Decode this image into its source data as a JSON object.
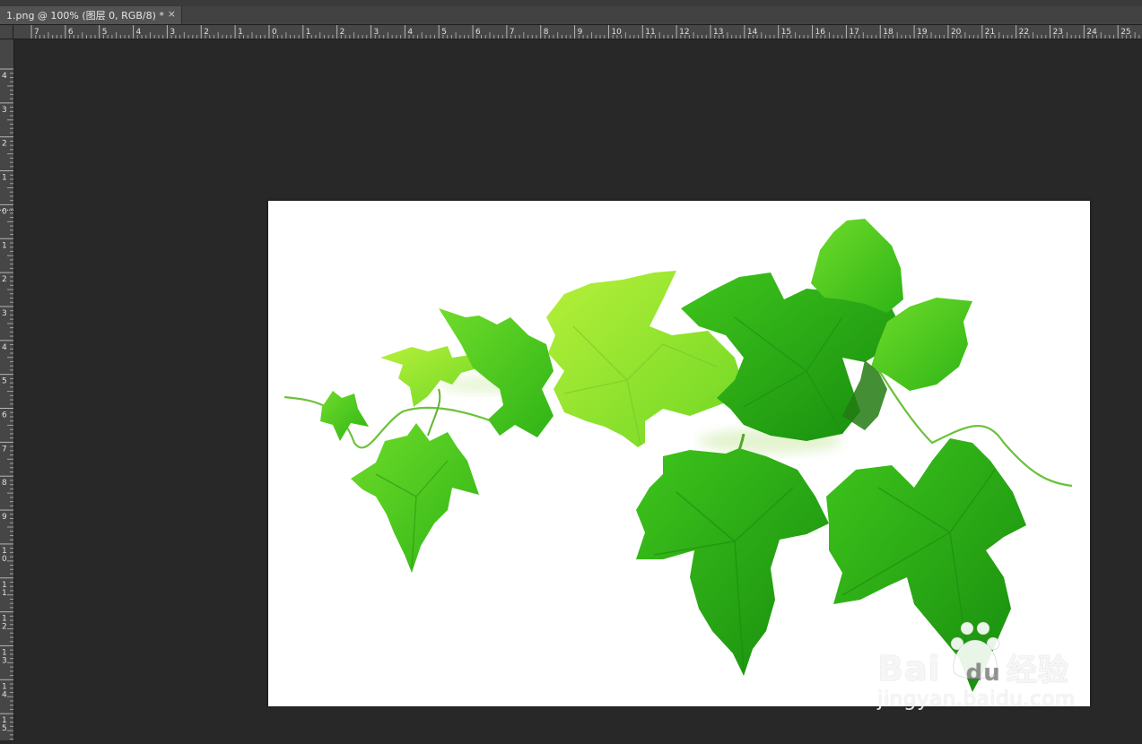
{
  "document_tab": {
    "title": "1.png @ 100% (图层 0, RGB/8) *",
    "close_glyph": "×"
  },
  "rulers": {
    "horizontal_labels": [
      "7",
      "6",
      "5",
      "4",
      "3",
      "2",
      "1",
      "0",
      "1",
      "2",
      "3",
      "4",
      "5",
      "6",
      "7",
      "8",
      "9",
      "10",
      "11",
      "12",
      "13",
      "14",
      "15",
      "16",
      "17",
      "18",
      "19",
      "20",
      "21",
      "22",
      "23",
      "24",
      "25"
    ],
    "vertical_labels": [
      "4",
      "3",
      "2",
      "1",
      "0",
      "1",
      "2",
      "3",
      "4",
      "5",
      "6",
      "7",
      "8",
      "9",
      "10",
      "11",
      "12",
      "13",
      "14",
      "15"
    ]
  },
  "canvas": {
    "background": "#ffffff",
    "subject": "green-hop-vine-leaves"
  },
  "watermark": {
    "logo_text": "Bai",
    "logo_suffix": "du",
    "brand_cn": "经验",
    "url": "jingyan.baidu.com"
  },
  "colors": {
    "workspace": "#282828",
    "ruler": "#464646",
    "leaf_light": "#9be22e",
    "leaf_mid": "#4fcf1d",
    "leaf_dark": "#1f9e12"
  }
}
